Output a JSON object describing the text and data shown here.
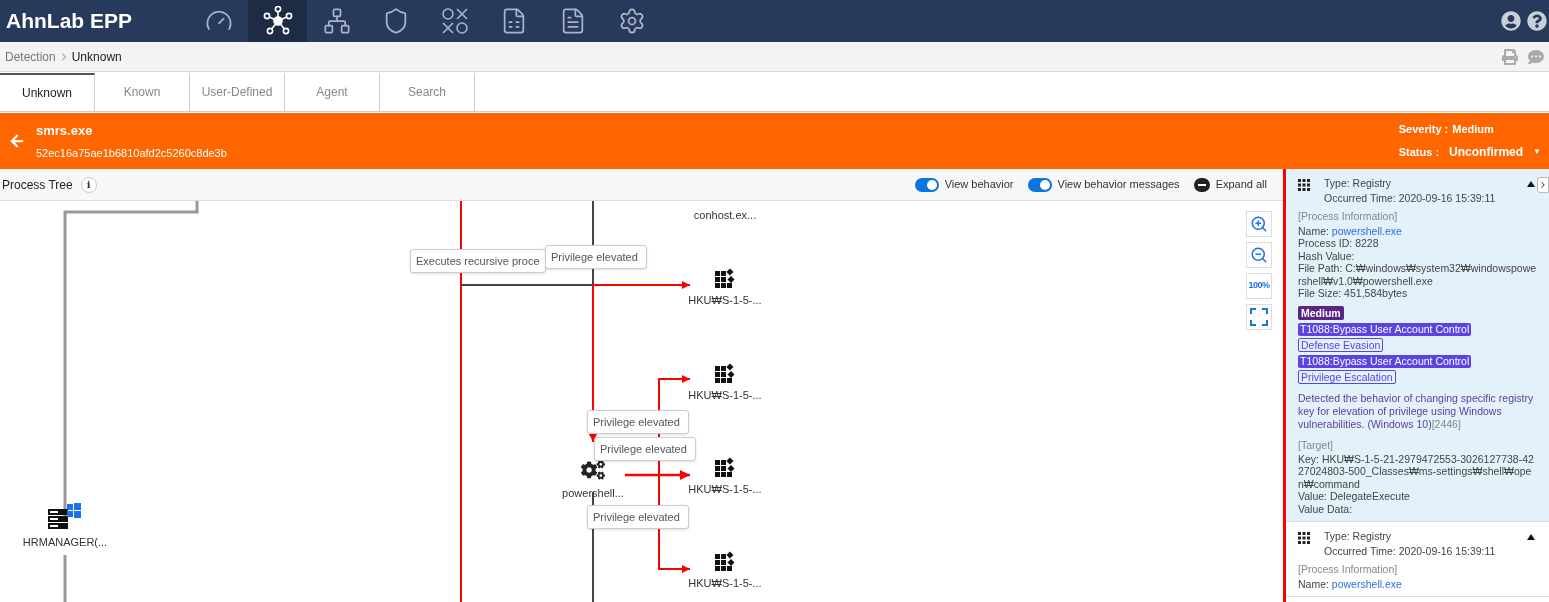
{
  "app": {
    "title": "AhnLab EPP"
  },
  "nav": [
    {
      "kind": "gauge",
      "selected": false
    },
    {
      "kind": "hub",
      "selected": true
    },
    {
      "kind": "hierarchy",
      "selected": false
    },
    {
      "kind": "shield",
      "selected": false
    },
    {
      "kind": "xo",
      "selected": false
    },
    {
      "kind": "sheet",
      "selected": false
    },
    {
      "kind": "document",
      "selected": false
    },
    {
      "kind": "gear",
      "selected": false
    }
  ],
  "breadcrumb": [
    "Detection",
    "Unknown"
  ],
  "tabs": [
    {
      "label": "Unknown",
      "selected": true
    },
    {
      "label": "Known",
      "selected": false
    },
    {
      "label": "User-Defined",
      "selected": false
    },
    {
      "label": "Agent",
      "selected": false
    },
    {
      "label": "Search",
      "selected": false
    }
  ],
  "detail": {
    "name": "smrs.exe",
    "hash": "52ec16a75ae1b6810afd2c5260c8de3b",
    "severity_label": "Severity :",
    "severity": "Medium",
    "status_label": "Status :",
    "status": "Unconfirmed",
    "status_caret": "▼"
  },
  "toolbar": {
    "title": "Process Tree",
    "info": "i",
    "toggles": [
      {
        "label": "View behavior",
        "on": true
      },
      {
        "label": "View behavior messages",
        "on": true
      }
    ],
    "expand": "Expand all"
  },
  "canvas": {
    "nodes": [
      {
        "kind": "label",
        "label": "conhost.ex..."
      },
      {
        "kind": "registry",
        "label": "HKU₩S-1-5-..."
      },
      {
        "kind": "registry",
        "label": "HKU₩S-1-5-..."
      },
      {
        "kind": "registry",
        "label": "HKU₩S-1-5-..."
      },
      {
        "kind": "registry",
        "label": "HKU₩S-1-5-..."
      },
      {
        "kind": "process",
        "label": "powershell..."
      },
      {
        "kind": "host",
        "label": "HRMANAGER(..."
      }
    ],
    "callouts": [
      "Executes recursive proce",
      "Privilege elevated",
      "Privilege elevated",
      "Privilege elevated",
      "Privilege elevated"
    ],
    "zoom": "100%"
  },
  "events": [
    {
      "selected": true,
      "expanded": true,
      "type_label": "Type:",
      "type": "Registry",
      "time_label": "Occurred Time:",
      "time": "2020-09-16 15:39:11",
      "process_heading": "[Process Information]",
      "process_fields": [
        {
          "label": "Name:",
          "value": "powershell.exe",
          "link": true
        },
        {
          "label": "Process ID:",
          "value": "8228",
          "link": false
        },
        {
          "label": "Hash Value:"
        },
        {
          "label": "File Path:",
          "value": "C:₩windows₩system32₩windowspowershell₩v1.0₩powershell.exe",
          "link": false
        },
        {
          "label": "File Size:",
          "value": "451,584bytes",
          "link": false
        }
      ],
      "severity": "Medium",
      "tactics": [
        {
          "technique": "T1088:Bypass User Account Control",
          "tactic": "Defense Evasion"
        },
        {
          "technique": "T1088:Bypass User Account Control",
          "tactic": "Privilege Escalation"
        }
      ],
      "description": "Detected the behavior of changing specific registry key for elevation of privilege using Windows vulnerabilities. (Windows 10)",
      "ref": "[2446]",
      "target_heading": "[Target]",
      "target_fields": [
        {
          "label": "Key:",
          "value": "HKU₩S-1-5-21-2979472553-3026127738-4227024803-500_Classes₩ms-settings₩shell₩open₩command",
          "link": false
        },
        {
          "label": "Value:",
          "value": "DelegateExecute",
          "link": false
        },
        {
          "label": "Value Data:"
        }
      ]
    },
    {
      "selected": false,
      "expanded": true,
      "type_label": "Type:",
      "type": "Registry",
      "time_label": "Occurred Time:",
      "time": "2020-09-16 15:39:11",
      "process_heading": "[Process Information]",
      "process_fields": [
        {
          "label": "Name:",
          "value": "powershell.exe",
          "link": true
        }
      ]
    }
  ]
}
